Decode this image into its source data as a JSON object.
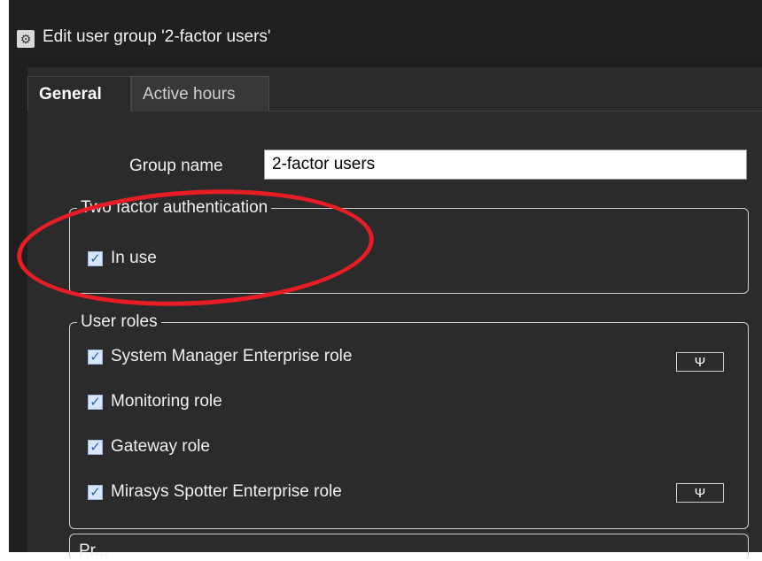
{
  "window": {
    "title": "Edit user group '2-factor users'",
    "icon": "gear-icon"
  },
  "tabs": [
    {
      "label": "General",
      "selected": true
    },
    {
      "label": "Active hours",
      "selected": false
    }
  ],
  "general": {
    "group_name_label": "Group name",
    "group_name_value": "2-factor users"
  },
  "two_factor": {
    "legend": "Two factor authentication",
    "in_use_label": "In use",
    "in_use_checked": true
  },
  "user_roles": {
    "legend": "User roles",
    "items": [
      {
        "label": "System Manager Enterprise role",
        "checked": true,
        "has_settings": true
      },
      {
        "label": "Monitoring role",
        "checked": true,
        "has_settings": false
      },
      {
        "label": "Gateway role",
        "checked": true,
        "has_settings": false
      },
      {
        "label": "Mirasys Spotter Enterprise role",
        "checked": true,
        "has_settings": true
      }
    ],
    "settings_icon": "wrench-icon"
  },
  "next_section": {
    "legend_partial": "Pr..."
  },
  "annotation": {
    "highlight_color": "#e81d25"
  },
  "checkmark": "✓",
  "wrench_glyph": "Ψ"
}
